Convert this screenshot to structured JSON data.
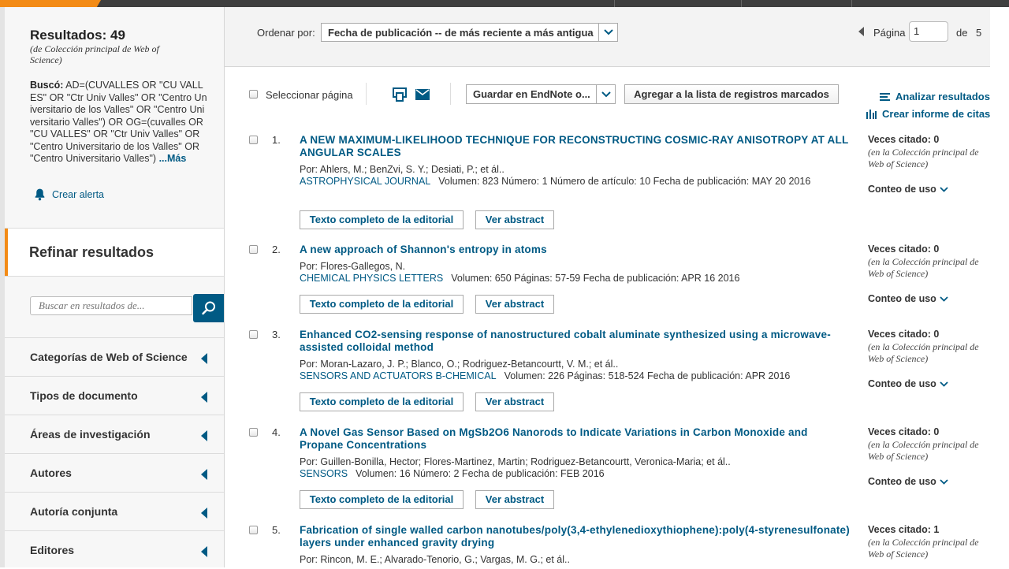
{
  "sidebar": {
    "results_label": "Resultados: 49",
    "results_sub": "(de Colección principal de Web of Science)",
    "query_label": "Buscó:",
    "query_text": " AD=(CUVALLES OR \"CU VALLES\" OR \"Ctr Univ Valles\" OR \"Centro Universitario de los Valles\" OR \"Centro Universitario Valles\") OR OG=(cuvalles OR \"CU VALLES\" OR \"Ctr Univ Valles\" OR \"Centro Universitario de los Valles\" OR \"Centro Universitario Valles\") ",
    "more_link": "...Más",
    "create_alert": "Crear alerta",
    "refine_title": "Refinar resultados",
    "search_placeholder": "Buscar en resultados de...",
    "facets": [
      {
        "label": "Categorías de Web of Science"
      },
      {
        "label": "Tipos de documento"
      },
      {
        "label": "Áreas de investigación"
      },
      {
        "label": "Autores"
      },
      {
        "label": "Autoría conjunta"
      },
      {
        "label": "Editores"
      }
    ]
  },
  "toolbar": {
    "sort_label": "Ordenar por:",
    "sort_value": "Fecha de publicación -- de más reciente a más antigua",
    "page_label": "Página",
    "page_value": "1",
    "page_of": "de",
    "page_total": "5",
    "select_page": "Seleccionar página",
    "save_endnote": "Guardar en EndNote o...",
    "add_marked": "Agregar a la lista de registros marcados",
    "analyze": "Analizar resultados",
    "citation_report": "Crear informe de citas"
  },
  "records": [
    {
      "num": "1.",
      "title": "A NEW MAXIMUM-LIKELIHOOD TECHNIQUE FOR RECONSTRUCTING COSMIC-RAY ANISOTROPY AT ALL ANGULAR SCALES",
      "authors": "Por: Ahlers, M.; BenZvi, S. Y.; Desiati, P.; et ál..",
      "journal": "ASTROPHYSICAL JOURNAL",
      "details": "Volumen: 823   Número: 1    Número de artículo: 10   Fecha de publicación: MAY 20 2016",
      "cited": "Veces citado: 0",
      "cited_sub": "(en la Colección principal de Web of Science)",
      "usage": "Conteo de uso",
      "full_text": "Texto completo de la editorial",
      "abstract": "Ver abstract"
    },
    {
      "num": "2.",
      "title": "A new approach of Shannon's entropy in atoms",
      "authors": "Por: Flores-Gallegos, N.",
      "journal": "CHEMICAL PHYSICS LETTERS",
      "details": "Volumen: 650   Páginas: 57-59   Fecha de publicación: APR 16 2016",
      "cited": "Veces citado: 0",
      "cited_sub": "(en la Colección principal de Web of Science)",
      "usage": "Conteo de uso",
      "full_text": "Texto completo de la editorial",
      "abstract": "Ver abstract"
    },
    {
      "num": "3.",
      "title": "Enhanced CO2-sensing response of nanostructured cobalt aluminate synthesized using a microwave-assisted colloidal method",
      "authors": "Por: Moran-Lazaro, J. P.; Blanco, O.; Rodriguez-Betancourtt, V. M.; et ál..",
      "journal": "SENSORS AND ACTUATORS B-CHEMICAL",
      "details": "Volumen: 226   Páginas: 518-524   Fecha de publicación: APR 2016",
      "cited": "Veces citado: 0",
      "cited_sub": "(en la Colección principal de Web of Science)",
      "usage": "Conteo de uso",
      "full_text": "Texto completo de la editorial",
      "abstract": "Ver abstract"
    },
    {
      "num": "4.",
      "title": "A Novel Gas Sensor Based on MgSb2O6 Nanorods to Indicate Variations in Carbon Monoxide and Propane Concentrations",
      "authors": "Por: Guillen-Bonilla, Hector; Flores-Martinez, Martin; Rodriguez-Betancourtt, Veronica-Maria; et ál..",
      "journal": "SENSORS",
      "details": "Volumen: 16   Número: 2    Fecha de publicación: FEB 2016",
      "cited": "Veces citado: 0",
      "cited_sub": "(en la Colección principal de Web of Science)",
      "usage": "Conteo de uso",
      "full_text": "Texto completo de la editorial",
      "abstract": "Ver abstract"
    },
    {
      "num": "5.",
      "title": "Fabrication of single walled carbon nanotubes/poly(3,4-ethylenedioxythiophene):poly(4-styrenesulfonate) layers under enhanced gravity drying",
      "authors": "Por: Rincon, M. E.; Alvarado-Tenorio, G.; Vargas, M. G.; et ál..",
      "cited": "Veces citado: 1",
      "cited_sub": "(en la Colección principal de Web of Science)"
    }
  ],
  "colors": {
    "accent": "#f38b16",
    "link": "#005a84",
    "topbar": "#3e3e3e"
  }
}
